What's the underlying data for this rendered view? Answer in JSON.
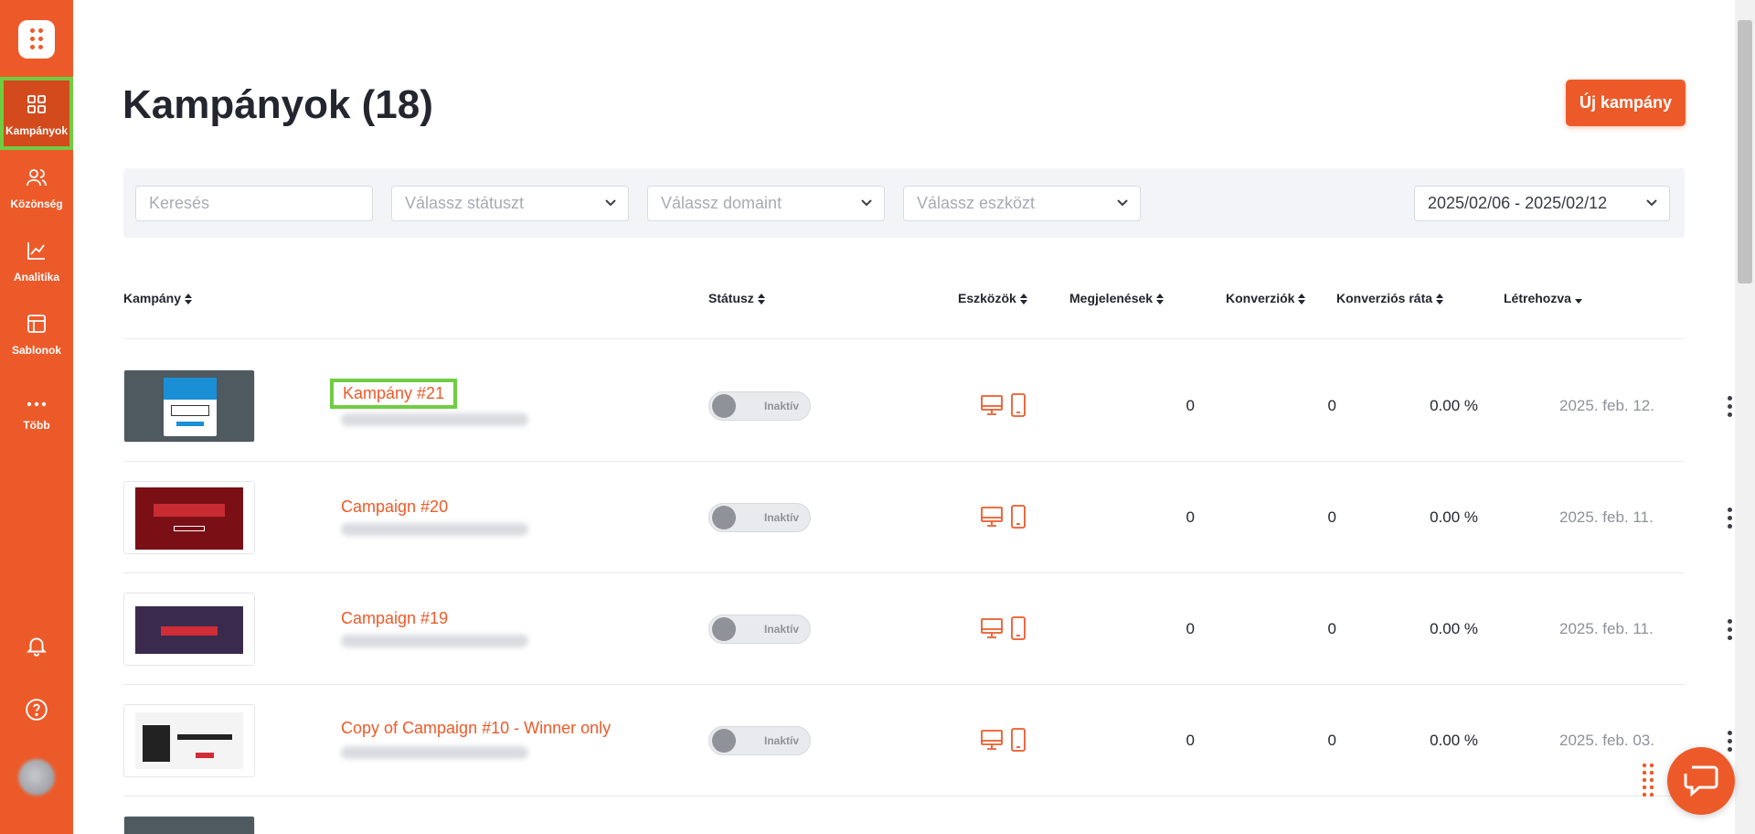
{
  "sidebar": {
    "items": [
      {
        "label": "Kampányok",
        "icon": "grid-icon"
      },
      {
        "label": "Közönség",
        "icon": "users-icon"
      },
      {
        "label": "Analitika",
        "icon": "chart-line-icon"
      },
      {
        "label": "Sablonok",
        "icon": "layout-icon"
      },
      {
        "label": "Több",
        "icon": "more-horizontal-icon"
      }
    ],
    "bottom_icons": [
      "bell-icon",
      "help-icon",
      "avatar"
    ]
  },
  "header": {
    "title": "Kampányok (18)",
    "new_button": "Új kampány"
  },
  "filters": {
    "search_placeholder": "Keresés",
    "status_select": "Válassz státuszt",
    "domain_select": "Válassz domaint",
    "device_select": "Válassz eszközt",
    "date_range": "2025/02/06 - 2025/02/12"
  },
  "table": {
    "columns": [
      "Kampány",
      "Státusz",
      "Eszközök",
      "Megjelenések",
      "Konverziók",
      "Konverziós ráta",
      "Létrehozva"
    ],
    "rows": [
      {
        "name": "Kampány #21",
        "status": "Inaktív",
        "impressions": "0",
        "conversions": "0",
        "rate": "0.00 %",
        "created": "2025. feb. 12."
      },
      {
        "name": "Campaign #20",
        "status": "Inaktív",
        "impressions": "0",
        "conversions": "0",
        "rate": "0.00 %",
        "created": "2025. feb. 11."
      },
      {
        "name": "Campaign #19",
        "status": "Inaktív",
        "impressions": "0",
        "conversions": "0",
        "rate": "0.00 %",
        "created": "2025. feb. 11."
      },
      {
        "name": "Copy of Campaign #10 - Winner only",
        "status": "Inaktív",
        "impressions": "0",
        "conversions": "0",
        "rate": "0.00 %",
        "created": "2025. feb. 03."
      }
    ]
  },
  "colors": {
    "accent": "#ed5a29",
    "sidebar_active": "#d34a1c",
    "highlight": "#6fcd42"
  }
}
